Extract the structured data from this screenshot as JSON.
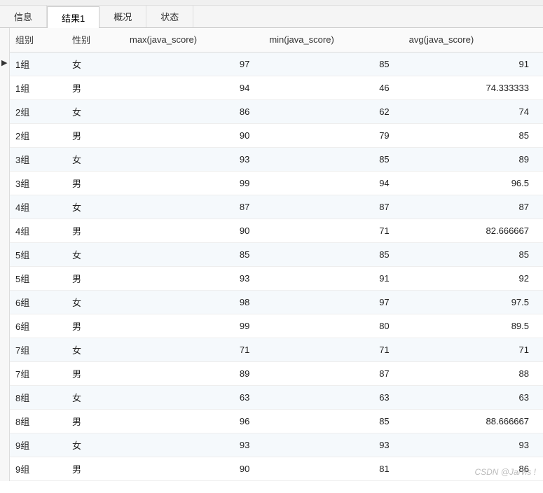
{
  "tabs": {
    "info": "信息",
    "result1": "结果1",
    "overview": "概况",
    "status": "状态"
  },
  "columns": {
    "group": "组别",
    "gender": "性别",
    "max": "max(java_score)",
    "min": "min(java_score)",
    "avg": "avg(java_score)"
  },
  "row_indicator": "▶",
  "rows": [
    {
      "group": "1组",
      "gender": "女",
      "max": "97",
      "min": "85",
      "avg": "91"
    },
    {
      "group": "1组",
      "gender": "男",
      "max": "94",
      "min": "46",
      "avg": "74.333333"
    },
    {
      "group": "2组",
      "gender": "女",
      "max": "86",
      "min": "62",
      "avg": "74"
    },
    {
      "group": "2组",
      "gender": "男",
      "max": "90",
      "min": "79",
      "avg": "85"
    },
    {
      "group": "3组",
      "gender": "女",
      "max": "93",
      "min": "85",
      "avg": "89"
    },
    {
      "group": "3组",
      "gender": "男",
      "max": "99",
      "min": "94",
      "avg": "96.5"
    },
    {
      "group": "4组",
      "gender": "女",
      "max": "87",
      "min": "87",
      "avg": "87"
    },
    {
      "group": "4组",
      "gender": "男",
      "max": "90",
      "min": "71",
      "avg": "82.666667"
    },
    {
      "group": "5组",
      "gender": "女",
      "max": "85",
      "min": "85",
      "avg": "85"
    },
    {
      "group": "5组",
      "gender": "男",
      "max": "93",
      "min": "91",
      "avg": "92"
    },
    {
      "group": "6组",
      "gender": "女",
      "max": "98",
      "min": "97",
      "avg": "97.5"
    },
    {
      "group": "6组",
      "gender": "男",
      "max": "99",
      "min": "80",
      "avg": "89.5"
    },
    {
      "group": "7组",
      "gender": "女",
      "max": "71",
      "min": "71",
      "avg": "71"
    },
    {
      "group": "7组",
      "gender": "男",
      "max": "89",
      "min": "87",
      "avg": "88"
    },
    {
      "group": "8组",
      "gender": "女",
      "max": "63",
      "min": "63",
      "avg": "63"
    },
    {
      "group": "8组",
      "gender": "男",
      "max": "96",
      "min": "85",
      "avg": "88.666667"
    },
    {
      "group": "9组",
      "gender": "女",
      "max": "93",
      "min": "93",
      "avg": "93"
    },
    {
      "group": "9组",
      "gender": "男",
      "max": "90",
      "min": "81",
      "avg": "86"
    }
  ],
  "watermark": "CSDN @Jarvis !"
}
